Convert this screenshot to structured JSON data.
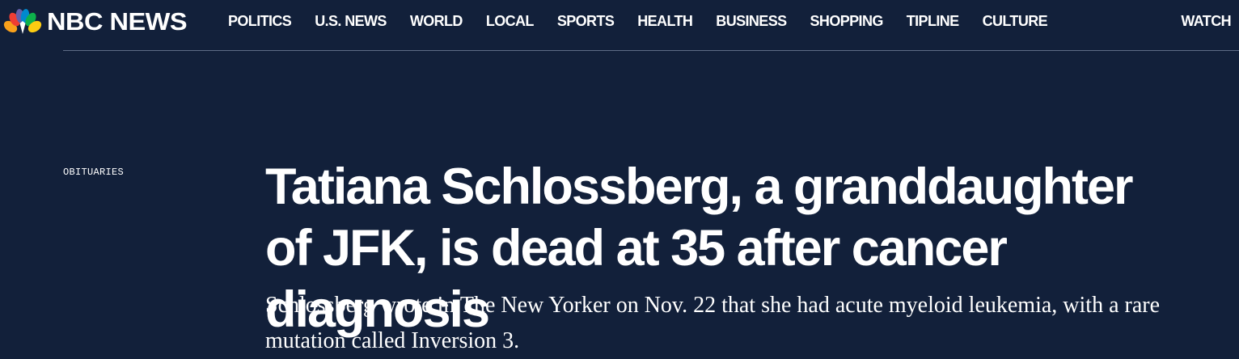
{
  "header": {
    "logo_text": "NBC NEWS",
    "nav": [
      "POLITICS",
      "U.S. NEWS",
      "WORLD",
      "LOCAL",
      "SPORTS",
      "HEALTH",
      "BUSINESS",
      "SHOPPING",
      "TIPLINE",
      "CULTURE"
    ],
    "watch_label": "WATCH"
  },
  "article": {
    "section": "OBITUARIES",
    "headline": "Tatiana Schlossberg, a granddaughter of JFK, is dead at 35 after cancer diagnosis",
    "dek": "Schlossberg wrote in The New Yorker on Nov. 22 that she had acute myeloid leukemia, with a rare mutation called Inversion 3."
  },
  "colors": {
    "background": "#12203a",
    "text": "#ffffff",
    "divider": "#5d6b85",
    "peacock": [
      "#f9a11b",
      "#ef3e33",
      "#6460aa",
      "#0089cf",
      "#0db14b",
      "#fccc12"
    ]
  },
  "icons": {
    "logo": "nbc-peacock-icon"
  }
}
